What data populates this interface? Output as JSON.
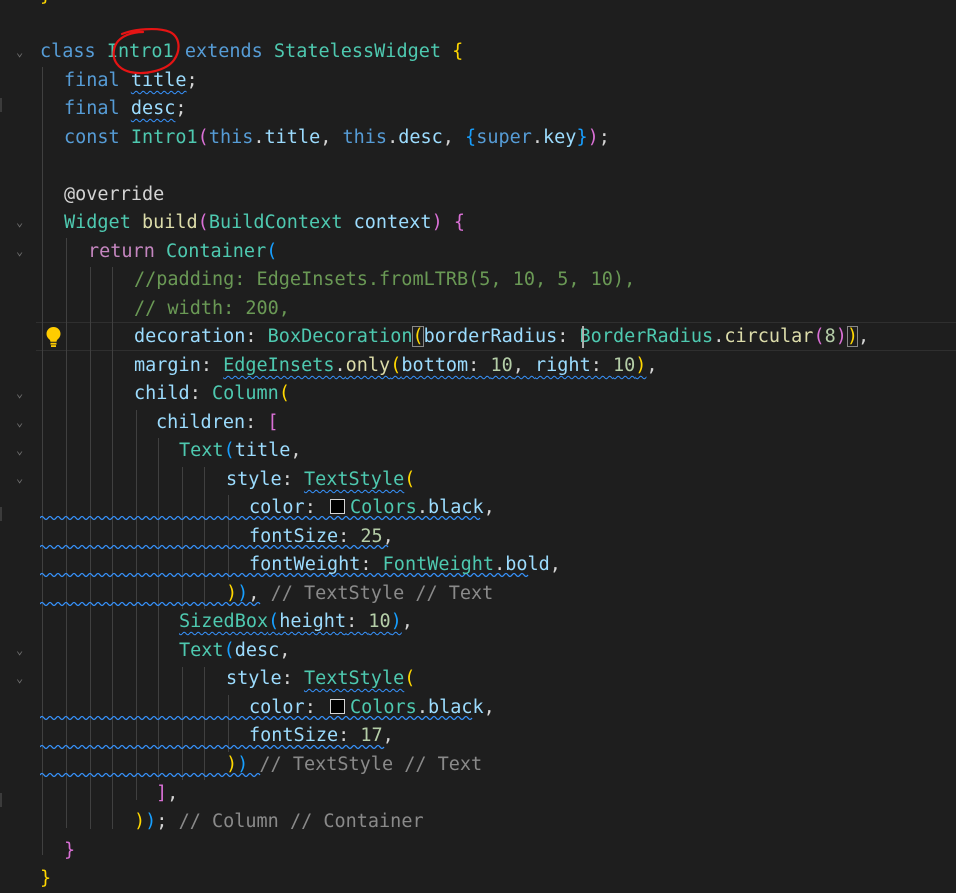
{
  "editor": {
    "language": "dart",
    "lines": {
      "l0": "}",
      "l1a": "class",
      "l1b": "Intro1",
      "l1c": "extends",
      "l1d": "StatelessWidget",
      "l1e": "{",
      "l2a": "final",
      "l2b": "title",
      "l2c": ";",
      "l3a": "final",
      "l3b": "desc",
      "l3c": ";",
      "l4a": "const",
      "l4b": "Intro1",
      "l4c": "(",
      "l4d": "this",
      "l4e": ".",
      "l4f": "title",
      "l4g": ", ",
      "l4h": "this",
      "l4i": ".",
      "l4j": "desc",
      "l4k": ", ",
      "l4l": "{",
      "l4m": "super",
      "l4n": ".",
      "l4o": "key",
      "l4p": "}",
      "l4q": ")",
      "l4r": ";",
      "l6": "@override",
      "l7a": "Widget",
      "l7b": "build",
      "l7c": "(",
      "l7d": "BuildContext",
      "l7e": "context",
      "l7f": ")",
      "l7g": "{",
      "l8a": "return",
      "l8b": "Container",
      "l8c": "(",
      "l9": "//padding: EdgeInsets.fromLTRB(5, 10, 5, 10),",
      "l10": "// width: 200,",
      "l11a": "decoration",
      "l11b": ": ",
      "l11c": "BoxDecoration",
      "l11d": "(",
      "l11e": "borderRadius",
      "l11f": ":",
      "l11g": " BorderRadius",
      "l11h": ".",
      "l11i": "circular",
      "l11j": "(",
      "l11k": "8",
      "l11l": ")",
      "l11m": ")",
      "l11n": ",",
      "l12a": "margin",
      "l12b": ": ",
      "l12c": "EdgeInsets",
      "l12d": ".",
      "l12e": "only",
      "l12f": "(",
      "l12g": "bottom",
      "l12h": ": ",
      "l12i": "10",
      "l12j": ", ",
      "l12k": "right",
      "l12l": ": ",
      "l12m": "10",
      "l12n": ")",
      "l12o": ",",
      "l13a": "child",
      "l13b": ": ",
      "l13c": "Column",
      "l13d": "(",
      "l14a": "children",
      "l14b": ": ",
      "l14c": "[",
      "l15a": "Text",
      "l15b": "(",
      "l15c": "title",
      "l15d": ",",
      "l16a": "style",
      "l16b": ": ",
      "l16c": "TextStyle",
      "l16d": "(",
      "l17a": "color",
      "l17b": ": ",
      "l17c": "Colors",
      "l17d": ".",
      "l17e": "black",
      "l17f": ",",
      "l18a": "fontSize",
      "l18b": ": ",
      "l18c": "25",
      "l18d": ",",
      "l19a": "fontWeight",
      "l19b": ": ",
      "l19c": "FontWeight",
      "l19d": ".",
      "l19e": "bold",
      "l19f": ",",
      "l20a": ")",
      "l20b": ")",
      "l20c": ", ",
      "l20d": "// TextStyle // Text",
      "l21a": "SizedBox",
      "l21b": "(",
      "l21c": "height",
      "l21d": ": ",
      "l21e": "10",
      "l21f": ")",
      "l21g": ",",
      "l22a": "Text",
      "l22b": "(",
      "l22c": "desc",
      "l22d": ",",
      "l23a": "style",
      "l23b": ": ",
      "l23c": "TextStyle",
      "l23d": "(",
      "l24a": "color",
      "l24b": ": ",
      "l24c": "Colors",
      "l24d": ".",
      "l24e": "black",
      "l24f": ",",
      "l25a": "fontSize",
      "l25b": ": ",
      "l25c": "17",
      "l25d": ",",
      "l26a": ")",
      "l26b": ")",
      "l26c": " ",
      "l26d": "// TextStyle // Text",
      "l27a": "]",
      "l27b": ",",
      "l28a": ")",
      "l28b": ")",
      "l28c": "; ",
      "l28d": "// Column // Container",
      "l29": "}",
      "l30": "}"
    }
  },
  "colors": {
    "background": "#1e1e1e",
    "keyword": "#569cd6",
    "control": "#c586c0",
    "class": "#4ec9b0",
    "function": "#dcdcaa",
    "variable": "#9cdcfe",
    "number": "#b5cea8",
    "comment": "#6a9955",
    "bracket_level1": "#ffd700",
    "bracket_level2": "#da70d6",
    "bracket_level3": "#179fff",
    "squiggle": "#3794ff",
    "annotation_red": "#e51414"
  },
  "icons": {
    "lightbulb": "lightbulb-icon",
    "fold": "chevron-down-icon",
    "color_swatch": "color-swatch-icon",
    "annotation": "red-ink-circle"
  }
}
